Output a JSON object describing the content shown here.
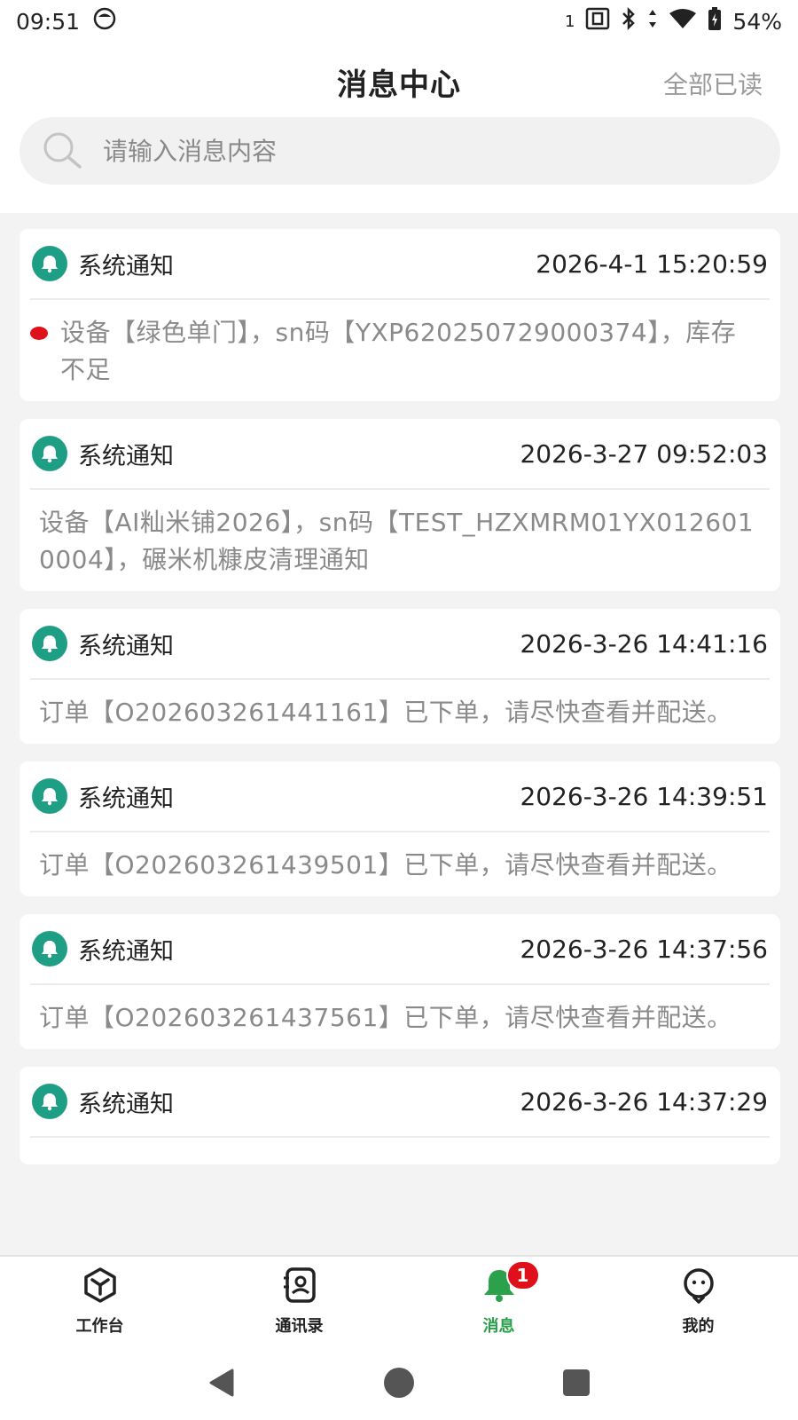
{
  "status_bar": {
    "time": "09:51",
    "sim": "1",
    "battery": "54%"
  },
  "header": {
    "title": "消息中心",
    "mark_all_read": "全部已读"
  },
  "search": {
    "placeholder": "请输入消息内容"
  },
  "messages": [
    {
      "type": "系统通知",
      "time": "2026-4-1 15:20:59",
      "content": "设备【绿色单门】，sn码【YXP620250729000374】，库存不足",
      "unread": true
    },
    {
      "type": "系统通知",
      "time": "2026-3-27 09:52:03",
      "content": "设备【AI籼米铺2026】，sn码【TEST_HZXMRM01YX0126010004】，碾米机糠皮清理通知",
      "unread": false
    },
    {
      "type": "系统通知",
      "time": "2026-3-26 14:41:16",
      "content": "订单【O202603261441161】已下单，请尽快查看并配送。",
      "unread": false
    },
    {
      "type": "系统通知",
      "time": "2026-3-26 14:39:51",
      "content": "订单【O202603261439501】已下单，请尽快查看并配送。",
      "unread": false
    },
    {
      "type": "系统通知",
      "time": "2026-3-26 14:37:56",
      "content": "订单【O202603261437561】已下单，请尽快查看并配送。",
      "unread": false
    },
    {
      "type": "系统通知",
      "time": "2026-3-26 14:37:29",
      "content": "",
      "unread": false
    }
  ],
  "tabs": [
    {
      "label": "工作台",
      "icon": "workbench-icon",
      "active": false
    },
    {
      "label": "通讯录",
      "icon": "contacts-icon",
      "active": false
    },
    {
      "label": "消息",
      "icon": "bell-icon",
      "active": true,
      "badge": "1"
    },
    {
      "label": "我的",
      "icon": "profile-icon",
      "active": false
    }
  ],
  "colors": {
    "accent": "#1f9e86",
    "active_tab": "#2aa14a",
    "badge": "#e0101a",
    "list_bg": "#f3f3f3"
  }
}
